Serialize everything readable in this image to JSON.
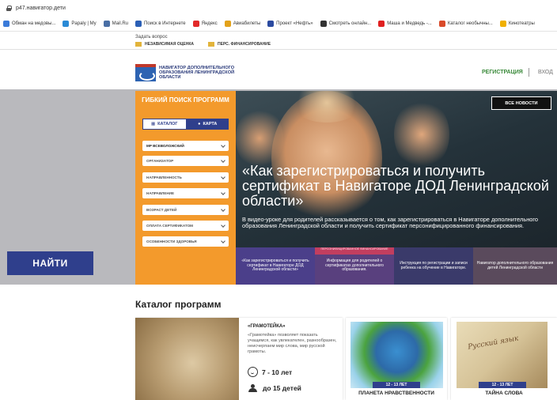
{
  "browser": {
    "url": "p47.навигатор.дети",
    "bookmarks": [
      {
        "label": "Обман на медовы...",
        "icon": "leaf-icon",
        "color": "#3b7bd9"
      },
      {
        "label": "Papaly | My",
        "icon": "heart-icon",
        "color": "#2a8ad6"
      },
      {
        "label": "Mail.Ru",
        "icon": "mail-icon",
        "color": "#4a6fa5"
      },
      {
        "label": "Поиск в Интернете",
        "icon": "search-icon",
        "color": "#2b5fb5"
      },
      {
        "label": "Яндекс",
        "icon": "yandex-icon",
        "color": "#e22a2a"
      },
      {
        "label": "Авиабилеты",
        "icon": "plane-icon",
        "color": "#e3a21a"
      },
      {
        "label": "Проект «Нефть»",
        "icon": "project-icon",
        "color": "#2b4aa0"
      },
      {
        "label": "Смотреть онлайн...",
        "icon": "hd-icon",
        "color": "#333333"
      },
      {
        "label": "Маша и Медведь -...",
        "icon": "youtube-icon",
        "color": "#e02020"
      },
      {
        "label": "Каталог необычны...",
        "icon": "gift-icon",
        "color": "#d94a2a"
      },
      {
        "label": "Кинотеатры",
        "icon": "film-icon",
        "color": "#f0b000"
      }
    ]
  },
  "site": {
    "ask_question": "Задать вопрос",
    "topline": [
      "НЕЗАВИСИМАЯ ОЦЕНКА",
      "ПЕРС. ФИНАНСИРОВАНИЕ"
    ],
    "logo_text": "НАВИГАТОР ДОПОЛНИТЕЛЬНОГО ОБРАЗОВАНИЯ ЛЕНИНГРАДСКОЙ ОБЛАСТИ",
    "register": "РЕГИСТРАЦИЯ",
    "login": "ВХОД"
  },
  "search": {
    "title": "ГИБКИЙ ПОИСК ПРОГРАММ",
    "tab_catalog": "КАТАЛОГ",
    "tab_map": "КАРТА",
    "filters": [
      "МР ВСЕВОЛОЖСКИЙ",
      "ОРГАНИЗАТОР",
      "НАПРАВЛЕННОСТЬ",
      "НАПРАВЛЕНИЕ",
      "ВОЗРАСТ ДЕТЕЙ",
      "ОПЛАТА СЕРТИФИКАТОМ",
      "ОСОБЕННОСТИ ЗДОРОВЬЯ"
    ],
    "find": "НАЙТИ"
  },
  "hero": {
    "news_button": "ВСЕ НОВОСТИ",
    "title": "«Как зарегистрироваться и получить сертификат в Навигаторе ДОД Ленинградской области»",
    "text": "В видео-уроке для родителей рассказывается о том, как зарегистрироваться в Навигаторе дополнительного образования Ленинградской области и получить сертификат персонифицированного финансирования.",
    "thumbs": [
      "«Как зарегистрироваться и получить сертификат в Навигаторе ДОД Ленинградской области»",
      "Информация для родителей о сертификатах дополнительного образования.",
      "Инструкция по регистрации и записи ребенка на обучение в Навигаторе.",
      "Навигатор дополнительного образования детей Ленинградской области"
    ],
    "thumb2_ribbon": "ПЕРСОНИФИЦИРОВАННОЕ ФИНАНСИРОВАНИЕ"
  },
  "catalog": {
    "title": "Каталог программ",
    "featured": {
      "name": "«ГРАМОТЕЙКА»",
      "desc": "«Грамотейка» позволяет показать учащимся, как увлекателен, разнообразен, неисчерпаем мир слова, мир русской грамоты.",
      "age": "7 - 10 лет",
      "group": "до 15 детей"
    },
    "cards": [
      {
        "age": "12 - 13 ЛЕТ",
        "name": "ПЛАНЕТА НРАВСТВЕННОСТИ"
      },
      {
        "age": "12 - 13 ЛЕТ",
        "name": "ТАЙНА СЛОВА"
      }
    ]
  }
}
